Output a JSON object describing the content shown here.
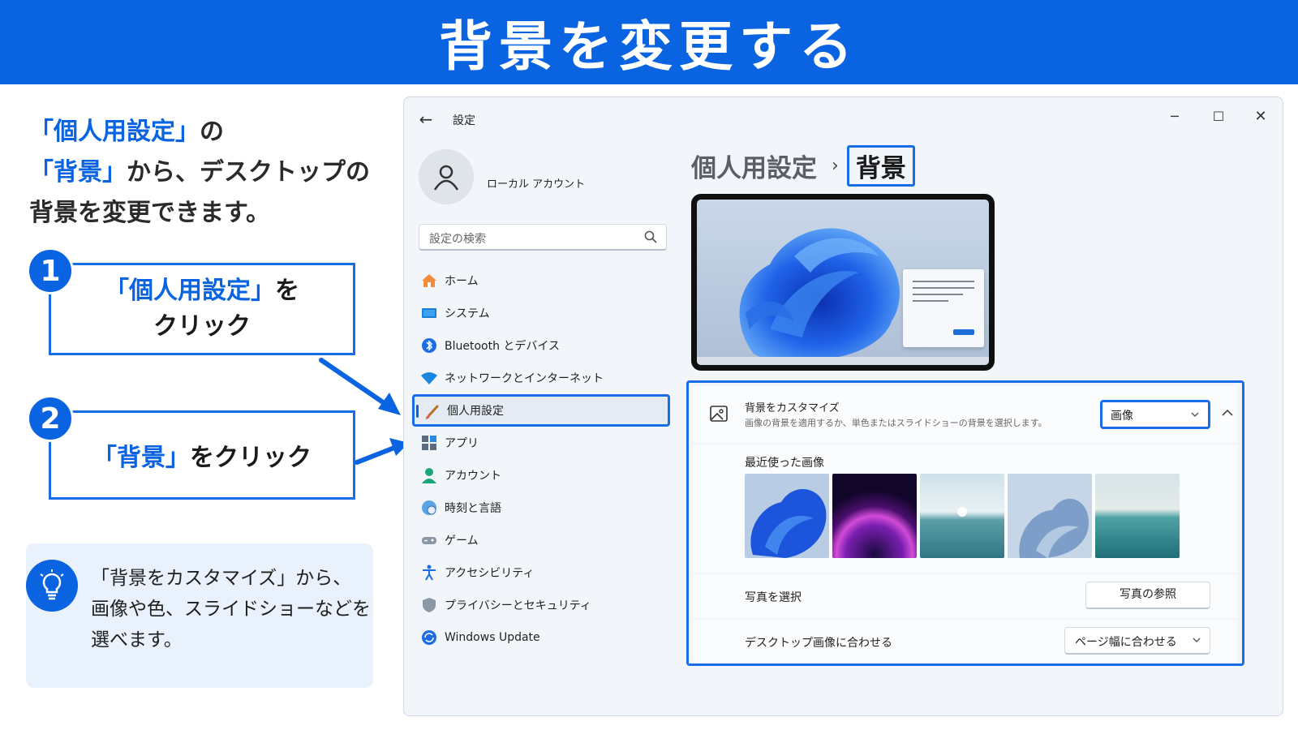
{
  "banner": {
    "title": "背景を変更する"
  },
  "intro": {
    "line1_highlight": "「個人用設定」",
    "line1_rest": "の",
    "line2_highlight": "「背景」",
    "line2_rest": "から、デスクトップの",
    "line3": "背景を変更できます。"
  },
  "steps": [
    {
      "number": "1",
      "highlight": "「個人用設定」",
      "rest": "を",
      "line2": "クリック"
    },
    {
      "number": "2",
      "highlight": "「背景」",
      "rest": "をクリック"
    }
  ],
  "tip": {
    "icon": "lightbulb-icon",
    "line1": "「背景をカスタマイズ」から、",
    "line2": "画像や色、スライドショーなどを",
    "line3": "選べます。"
  },
  "window": {
    "title": "設定",
    "account_name": "ローカル アカウント",
    "search_placeholder": "設定の検索",
    "nav_items": [
      {
        "label": "ホーム",
        "icon": "home-icon"
      },
      {
        "label": "システム",
        "icon": "monitor-icon"
      },
      {
        "label": "Bluetooth とデバイス",
        "icon": "bluetooth-icon"
      },
      {
        "label": "ネットワークとインターネット",
        "icon": "wifi-icon"
      },
      {
        "label": "個人用設定",
        "icon": "brush-icon",
        "active": true
      },
      {
        "label": "アプリ",
        "icon": "apps-icon"
      },
      {
        "label": "アカウント",
        "icon": "person-icon"
      },
      {
        "label": "時刻と言語",
        "icon": "globe-clock-icon"
      },
      {
        "label": "ゲーム",
        "icon": "gamepad-icon"
      },
      {
        "label": "アクセシビリティ",
        "icon": "accessibility-icon"
      },
      {
        "label": "プライバシーとセキュリティ",
        "icon": "shield-icon"
      },
      {
        "label": "Windows Update",
        "icon": "update-icon"
      }
    ],
    "breadcrumb": {
      "parent": "個人用設定",
      "separator": "›",
      "current": "背景"
    },
    "background": {
      "title": "背景をカスタマイズ",
      "description": "画像の背景を適用するか、単色またはスライドショーの背景を選択します。",
      "selected": "画像",
      "recent_title": "最近使った画像",
      "thumbnails": [
        "blue-bloom",
        "purple-glow",
        "lake-horizon",
        "pale-bloom",
        "teal-lake"
      ],
      "photo_label": "写真を選択",
      "browse_button": "写真の参照",
      "fit_label": "デスクトップ画像に合わせる",
      "fit_value": "ページ幅に合わせる"
    }
  },
  "colors": {
    "accent": "#0a63e0",
    "highlight_border": "#1a6de6",
    "window_bg": "#f2f5fa"
  }
}
